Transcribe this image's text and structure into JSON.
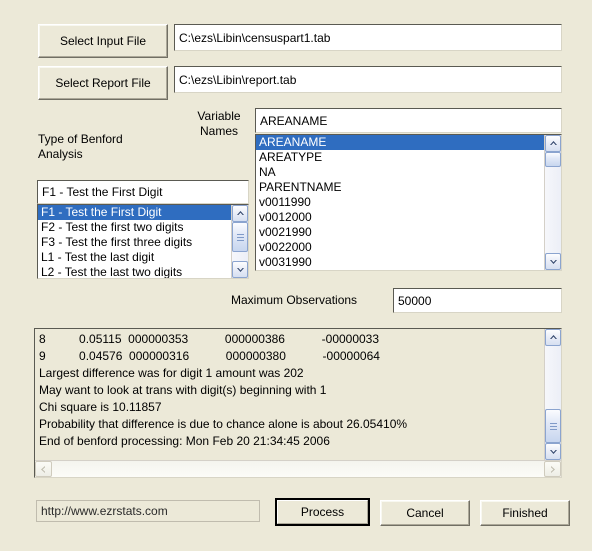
{
  "buttons": {
    "select_input_file": "Select Input File",
    "select_report_file": "Select Report File",
    "process": "Process",
    "cancel": "Cancel",
    "finished": "Finished"
  },
  "fields": {
    "input_file": "C:\\ezs\\Libin\\censuspart1.tab",
    "report_file": "C:\\ezs\\Libin\\report.tab",
    "max_observations": "50000",
    "url": "http://www.ezrstats.com"
  },
  "labels": {
    "benford_type": "Type of Benford\nAnalysis",
    "variable_names": "Variable\nNames",
    "max_observations": "Maximum Observations"
  },
  "benford": {
    "selected": "F1 - Test the First Digit",
    "options": [
      "F1 - Test the First Digit",
      "F2 - Test the first two digits",
      "F3 - Test the first three digits",
      "L1 - Test the last digit",
      "L2 - Test the last two digits"
    ]
  },
  "variables": {
    "selected": "AREANAME",
    "options": [
      "AREANAME",
      "AREATYPE",
      "NA",
      "PARENTNAME",
      "v0011990",
      "v0012000",
      "v0021990",
      "v0022000",
      "v0031990"
    ]
  },
  "output": {
    "lines": [
      "8          0.05115  000000353           000000386           -00000033",
      "9          0.04576  000000316           000000380           -00000064",
      "Largest difference was for digit 1 amount was 202",
      "May want to look at trans with digit(s) beginning with 1",
      "Chi square is 10.11857",
      "Probability that difference is due to chance alone is about 26.05410%",
      "End of benford processing: Mon Feb 20 21:34:45 2006"
    ]
  },
  "colors": {
    "dialog_background": "#ece9d8",
    "selection_blue": "#2f6dc0",
    "field_background": "#ffffff",
    "scrollbar_border": "#8ba4cf"
  },
  "icons": {
    "scroll_up": "chevron-up-icon",
    "scroll_down": "chevron-down-icon",
    "scroll_left": "chevron-left-icon",
    "scroll_right": "chevron-right-icon"
  }
}
